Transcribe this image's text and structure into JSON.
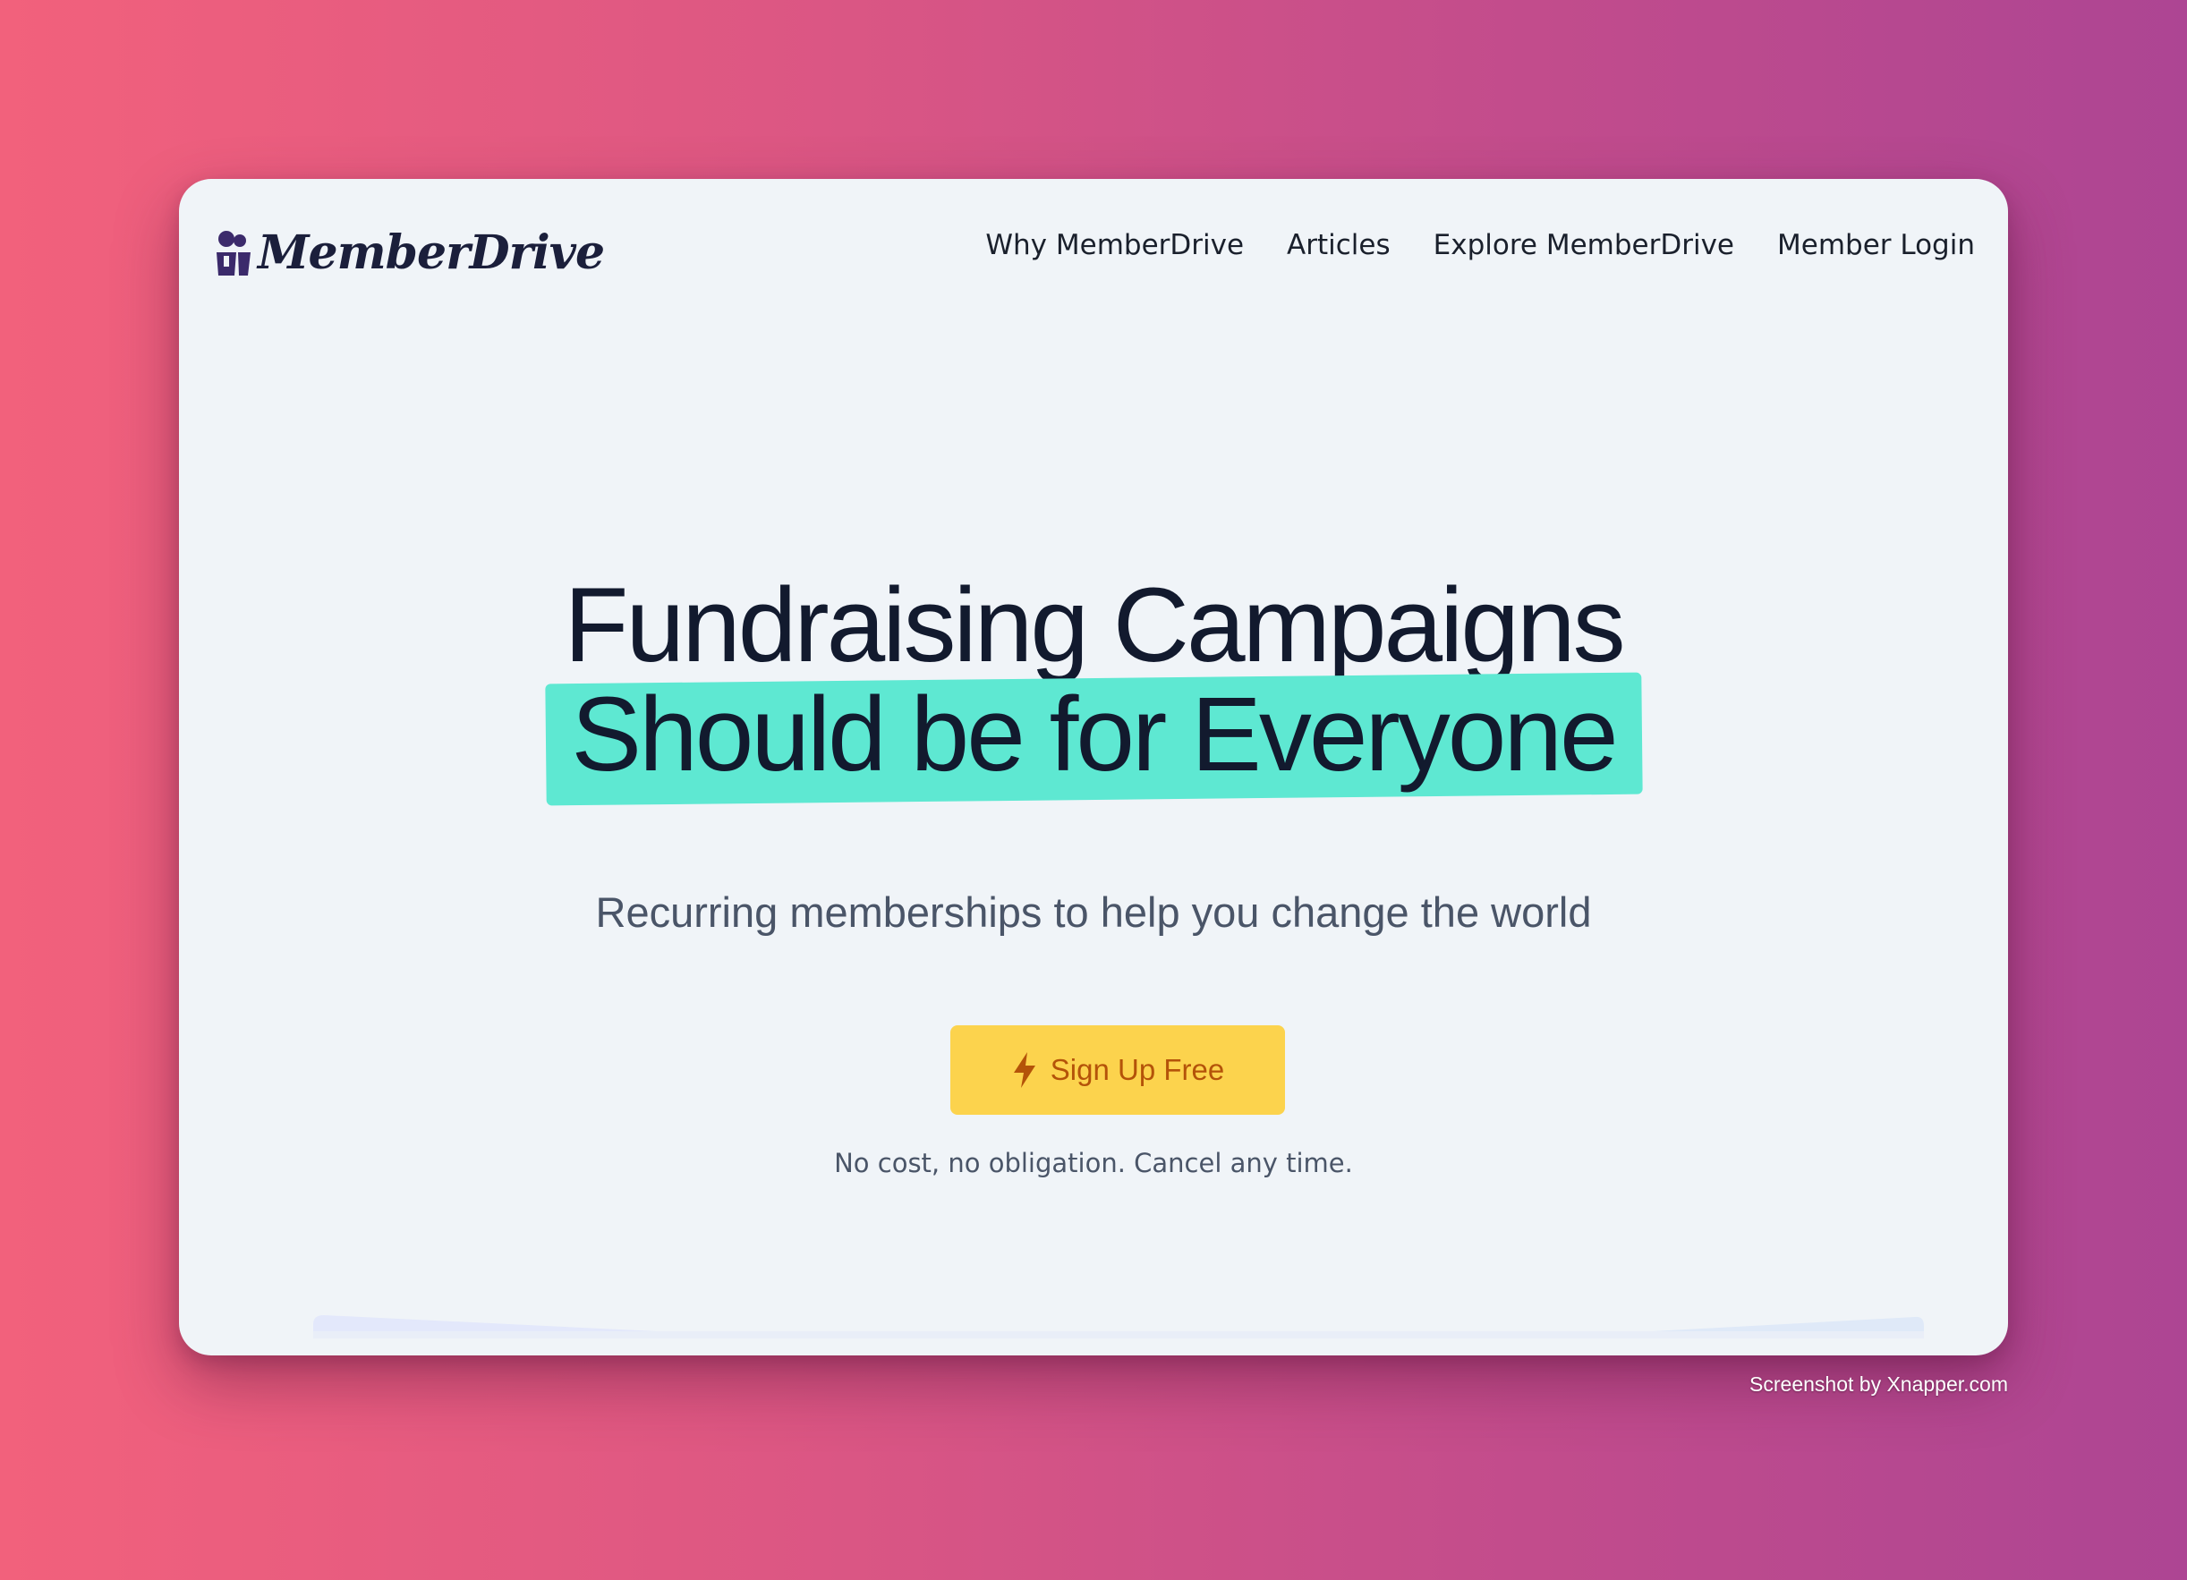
{
  "brand": {
    "name": "MemberDrive",
    "icon": "members-icon",
    "color": "#1b1f3b"
  },
  "nav": {
    "items": [
      {
        "label": "Why MemberDrive"
      },
      {
        "label": "Articles"
      },
      {
        "label": "Explore MemberDrive"
      },
      {
        "label": "Member Login"
      }
    ]
  },
  "hero": {
    "headline_line1": "Fundraising Campaigns",
    "headline_line2": "Should be for Everyone",
    "highlight_color": "#5ee8d2",
    "subtitle": "Recurring memberships to help you change the world"
  },
  "cta": {
    "label": "Sign Up Free",
    "icon": "lightning-bolt-icon",
    "background": "#fcd34d",
    "text_color": "#b45309"
  },
  "note": "No cost, no obligation. Cancel any time.",
  "credit": "Screenshot by Xnapper.com",
  "colors": {
    "page_background": "#f0f4f8",
    "gradient_start": "#f2617c",
    "gradient_end": "#ad4593"
  }
}
